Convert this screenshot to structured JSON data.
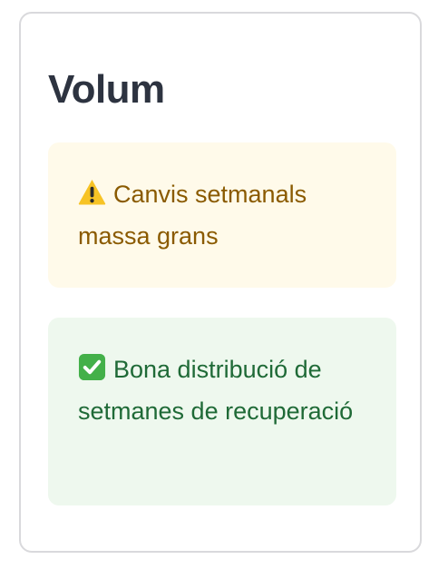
{
  "card": {
    "title": "Volum",
    "alerts": [
      {
        "type": "warning",
        "icon": "warning-icon",
        "text": "Canvis setmanals massa grans",
        "colors": {
          "background": "#fffaea",
          "text": "#8a5a00"
        }
      },
      {
        "type": "success",
        "icon": "check-mark-icon",
        "text": "Bona distribució de setmanes de recuperació",
        "colors": {
          "background": "#eef8ee",
          "text": "#1f6a37"
        }
      }
    ]
  }
}
